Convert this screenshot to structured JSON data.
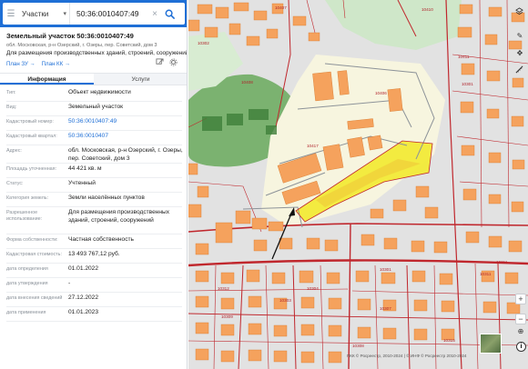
{
  "search": {
    "layer": "Участки",
    "query": "50:36:0010407:49",
    "clear_glyph": "×"
  },
  "parcel": {
    "title": "Земельный участок 50:36:0010407:49",
    "address_line": "обл. Московская, р-н Озерский, г. Озеры, пер. Советский, дом 3",
    "purpose_line": "Для размещения производственных зданий, строений, сооружений",
    "link_plan_zu": "План ЗУ →",
    "link_plan_kk": "План КК →"
  },
  "tabs": [
    {
      "label": "Информация",
      "active": true
    },
    {
      "label": "Услуги",
      "active": false
    }
  ],
  "details": [
    {
      "label": "Тип:",
      "value": "Объект недвижимости"
    },
    {
      "label": "Вид:",
      "value": "Земельный участок"
    },
    {
      "label": "Кадастровый номер:",
      "value": "50:36:0010407:49",
      "link": true
    },
    {
      "label": "Кадастровый квартал:",
      "value": "50:36:0010407",
      "link": true
    },
    {
      "label": "Адрес:",
      "value": "обл. Московская, р-н Озерский, г. Озеры, пер. Советский, дом 3"
    },
    {
      "label": "Площадь уточненная:",
      "value": "44 421 кв. м"
    },
    {
      "label": "Статус:",
      "value": "Учтенный"
    },
    {
      "label": "Категория земель:",
      "value": "Земли населённых пунктов"
    },
    {
      "label": "Разрешенное использование:",
      "value": "Для размещения производственных зданий, строений, сооружений"
    },
    {
      "label": "Форма собственности:",
      "value": "Частная собственность"
    },
    {
      "label": "Кадастровая стоимость:",
      "value": "13 493 767,12 руб."
    },
    {
      "label": "дата определения",
      "value": "01.01.2022"
    },
    {
      "label": "дата утверждения",
      "value": "-"
    },
    {
      "label": "дата внесения сведений",
      "value": "27.12.2022"
    },
    {
      "label": "дата применения",
      "value": "01.01.2023"
    }
  ],
  "map": {
    "labels": [
      "10407",
      "10302",
      "10301",
      "10408",
      "10311",
      "10311",
      "10309",
      "10307",
      "10406",
      "10417",
      "10410",
      "10411",
      "10301",
      "10304",
      "10303",
      "10312",
      "10315",
      "10308"
    ],
    "controls": {
      "zoom_in": "+",
      "zoom_out": "−",
      "info": "i"
    },
    "attribution": "ПКК © Росреестр, 2010-2024 | © ИНФ © Росреестр 2010-2024"
  },
  "colors": {
    "accent": "#1f6fd6",
    "building": "#f5a25d",
    "boundary": "#c0272d",
    "selected_parcel": "#f2ea37",
    "green_zone": "#58a24a"
  }
}
